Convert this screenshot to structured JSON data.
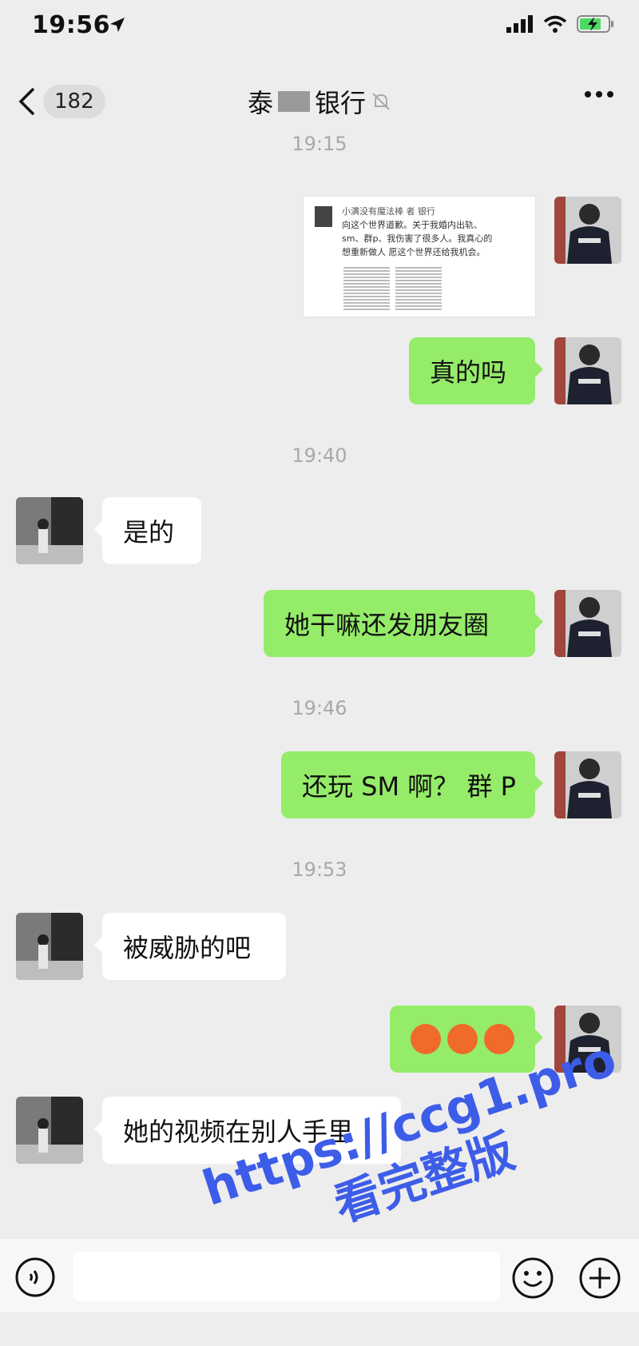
{
  "status_bar": {
    "time": "19:56"
  },
  "nav": {
    "unread_count": "182",
    "title_prefix": "泰",
    "title_suffix": "银行"
  },
  "messages": {
    "t1": "19:15",
    "image_card": {
      "header": "小满没有魔法棒 者",
      "header_tail": "银行",
      "line1": "向这个世界道歉。关于我婚内出轨、",
      "line2": "sm、群p、我伤害了很多人。我真心的",
      "line3": "想重新做人 愿这个世界还给我机会。"
    },
    "m1": "真的吗",
    "t2": "19:40",
    "m2": "是的",
    "m3": "她干嘛还发朋友圈",
    "t3": "19:46",
    "m4": "还玩 SM 啊？ 群 P",
    "t4": "19:53",
    "m5": "被威胁的吧",
    "m7": "她的视频在别人手里"
  },
  "watermark": {
    "url": "https://ccg1.pro",
    "sub": "看完整版"
  },
  "icons": {
    "back": "chevron-left-icon",
    "mute": "bell-off-icon",
    "more": "more-icon",
    "voice": "voice-icon",
    "emoji": "emoji-icon",
    "plus": "plus-icon",
    "location": "location-arrow-icon",
    "signal": "signal-icon",
    "wifi": "wifi-icon",
    "battery": "battery-charging-icon"
  }
}
